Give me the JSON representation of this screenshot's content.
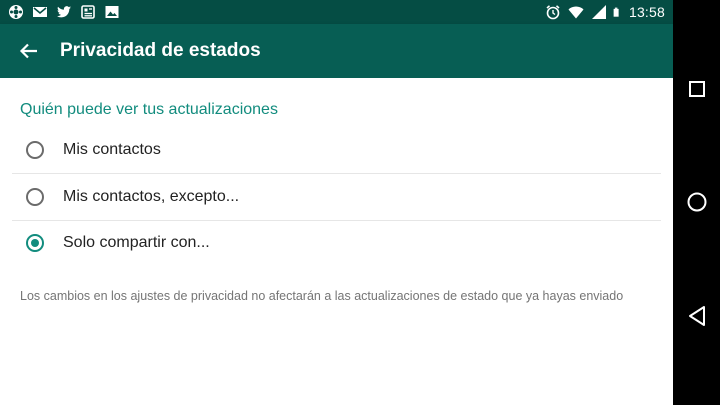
{
  "status_bar": {
    "time": "13:58",
    "left_icons": [
      "app-icon",
      "gmail-icon",
      "twitter-icon",
      "feed-icon",
      "image-icon"
    ],
    "right_icons": [
      "alarm-icon",
      "wifi-icon",
      "signal-icon",
      "battery-icon"
    ]
  },
  "app_bar": {
    "title": "Privacidad de estados",
    "back_icon": "arrow-back-icon",
    "color": "#075e54"
  },
  "section": {
    "header": "Quién puede ver tus actualizaciones",
    "accent_color": "#128c7e"
  },
  "options": [
    {
      "label": "Mis contactos",
      "selected": false
    },
    {
      "label": "Mis contactos, excepto...",
      "selected": false
    },
    {
      "label": "Solo compartir con...",
      "selected": true
    }
  ],
  "note": "Los cambios en los ajustes de privacidad no afectarán a las actualizaciones de estado que ya hayas enviado",
  "nav_bar": {
    "buttons": [
      "recents-icon",
      "home-icon",
      "back-icon"
    ]
  }
}
